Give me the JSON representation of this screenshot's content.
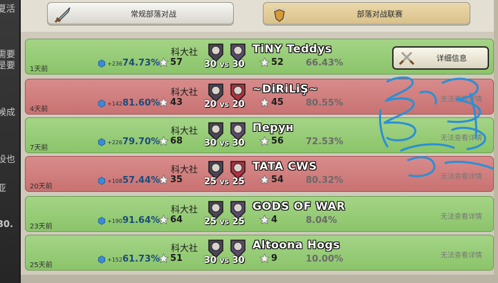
{
  "left_strip": [
    "夏活",
    "需要",
    "是要",
    "候成",
    "设也",
    "亚",
    "30."
  ],
  "tabs": [
    {
      "label": "常规部落对战",
      "icon": "sword-icon",
      "active": false
    },
    {
      "label": "部落对战联赛",
      "icon": "crossed-swords-shield-icon",
      "active": true
    }
  ],
  "rows": [
    {
      "result": "win",
      "date": "1天前",
      "clan": "科大社",
      "trophies": "+236",
      "our_pct": "74.73%",
      "our_stars": "57",
      "our_level": "6",
      "enemy_level": "6",
      "size": "30",
      "enemy_size": "30",
      "vs": "VS",
      "enemy_stars": "52",
      "enemy_pct": "66.43%",
      "enemy_name": "TiNY Teddys",
      "action": "详细信息"
    },
    {
      "result": "loss",
      "date": "4天前",
      "clan": "科大社",
      "trophies": "+142",
      "our_pct": "81.60%",
      "our_stars": "43",
      "our_level": "6",
      "enemy_level": "7",
      "size": "20",
      "enemy_size": "20",
      "vs": "VS",
      "enemy_stars": "45",
      "enemy_pct": "80.55%",
      "enemy_name": "~DiRiLiŞ~",
      "action": "无法查看详情"
    },
    {
      "result": "win",
      "date": "7天前",
      "clan": "科大社",
      "trophies": "+226",
      "our_pct": "79.70%",
      "our_stars": "68",
      "our_level": "6",
      "enemy_level": "9",
      "size": "30",
      "enemy_size": "30",
      "vs": "VS",
      "enemy_stars": "56",
      "enemy_pct": "72.53%",
      "enemy_name": "Перун",
      "action": "无法查看详情"
    },
    {
      "result": "loss",
      "date": "20天前",
      "clan": "科大社",
      "trophies": "+108",
      "our_pct": "57.44%",
      "our_stars": "35",
      "our_level": "5",
      "enemy_level": "4",
      "size": "25",
      "enemy_size": "25",
      "vs": "VS",
      "enemy_stars": "54",
      "enemy_pct": "80.32%",
      "enemy_name": "TATA CWS",
      "action": "无法查看详情"
    },
    {
      "result": "win",
      "date": "23天前",
      "clan": "科大社",
      "trophies": "+190",
      "our_pct": "91.64%",
      "our_stars": "64",
      "our_level": "5",
      "enemy_level": "4",
      "size": "25",
      "enemy_size": "25",
      "vs": "VS",
      "enemy_stars": "4",
      "enemy_pct": "8.04%",
      "enemy_name": "GODS OF WAR",
      "action": "无法查看详情"
    },
    {
      "result": "win",
      "date": "25天前",
      "clan": "科大社",
      "trophies": "+152",
      "our_pct": "61.73%",
      "our_stars": "51",
      "our_level": "5",
      "enemy_level": "8",
      "size": "30",
      "enemy_size": "30",
      "vs": "VS",
      "enemy_stars": "9",
      "enemy_pct": "10.00%",
      "enemy_name": "Altoona Hogs",
      "action": "无法查看详情"
    }
  ],
  "colors": {
    "win": "#93c973",
    "loss": "#cc7878",
    "scribble": "#2b8fd6",
    "accent_blue": "#1b4c7a"
  }
}
